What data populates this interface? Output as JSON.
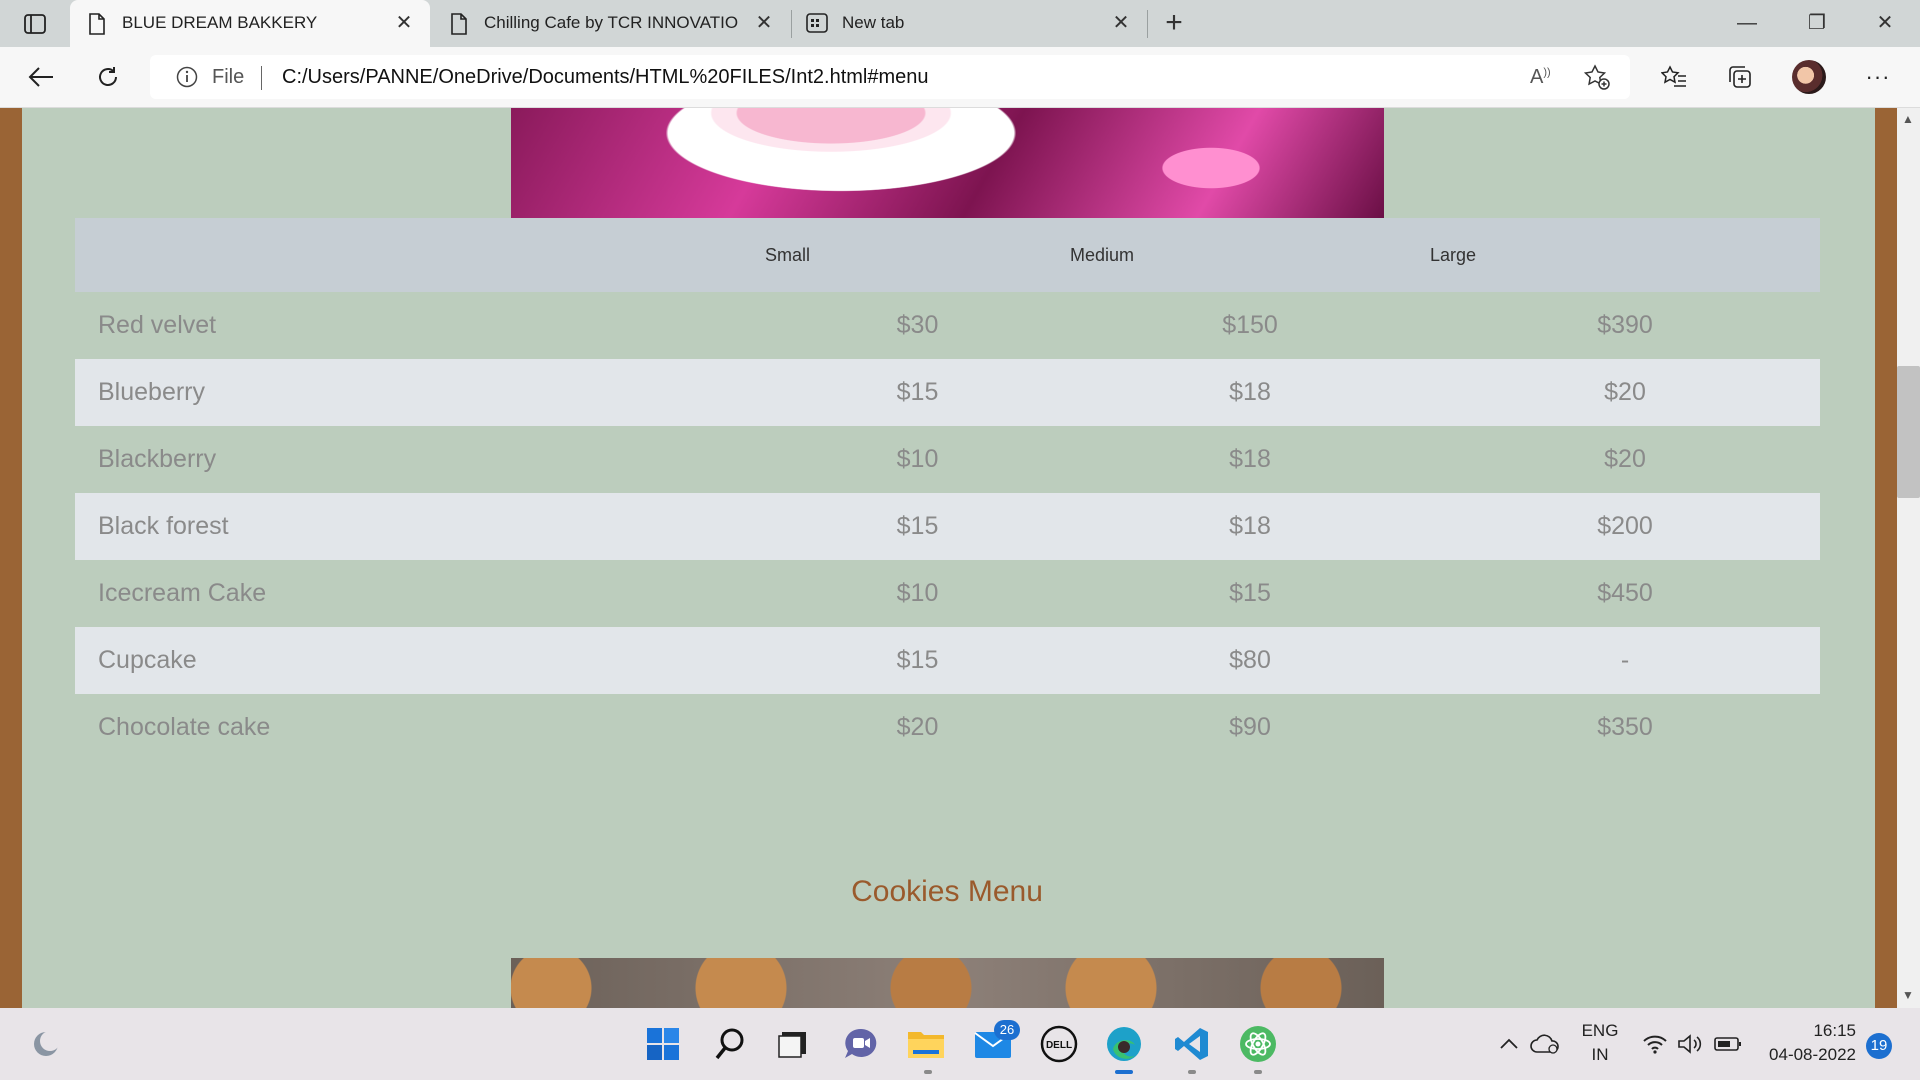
{
  "browser": {
    "tabs": [
      {
        "title": "BLUE DREAM BAKKERY",
        "active": true
      },
      {
        "title": "Chilling Cafe by TCR INNOVATIO",
        "active": false
      },
      {
        "title": "New tab",
        "active": false
      }
    ],
    "address": {
      "scheme_label": "File",
      "url": "C:/Users/PANNE/OneDrive/Documents/HTML%20FILES/Int2.html#menu"
    }
  },
  "page": {
    "table": {
      "headers": [
        "",
        "Small",
        "Medium",
        "Large"
      ],
      "rows": [
        {
          "name": "Red velvet",
          "small": "$30",
          "medium": "$150",
          "large": "$390"
        },
        {
          "name": "Blueberry",
          "small": "$15",
          "medium": "$18",
          "large": "$20"
        },
        {
          "name": "Blackberry",
          "small": "$10",
          "medium": "$18",
          "large": "$20"
        },
        {
          "name": "Black forest",
          "small": "$15",
          "medium": "$18",
          "large": "$200"
        },
        {
          "name": "Icecream Cake",
          "small": "$10",
          "medium": "$15",
          "large": "$450"
        },
        {
          "name": "Cupcake",
          "small": "$15",
          "medium": "$80",
          "large": "-"
        },
        {
          "name": "Chocolate cake",
          "small": "$20",
          "medium": "$90",
          "large": "$350"
        }
      ]
    },
    "cookies_heading": "Cookies Menu",
    "colors": {
      "page_background": "#bccdbd",
      "side_border": "#9a6435",
      "header_row": "#c6ced4",
      "striped_row": "#e2e6ea",
      "heading": "#9a5a2c"
    }
  },
  "taskbar": {
    "mail_badge": "26",
    "tray": {
      "language_line1": "ENG",
      "language_line2": "IN",
      "time": "16:15",
      "date": "04-08-2022",
      "notifications": "19"
    }
  }
}
